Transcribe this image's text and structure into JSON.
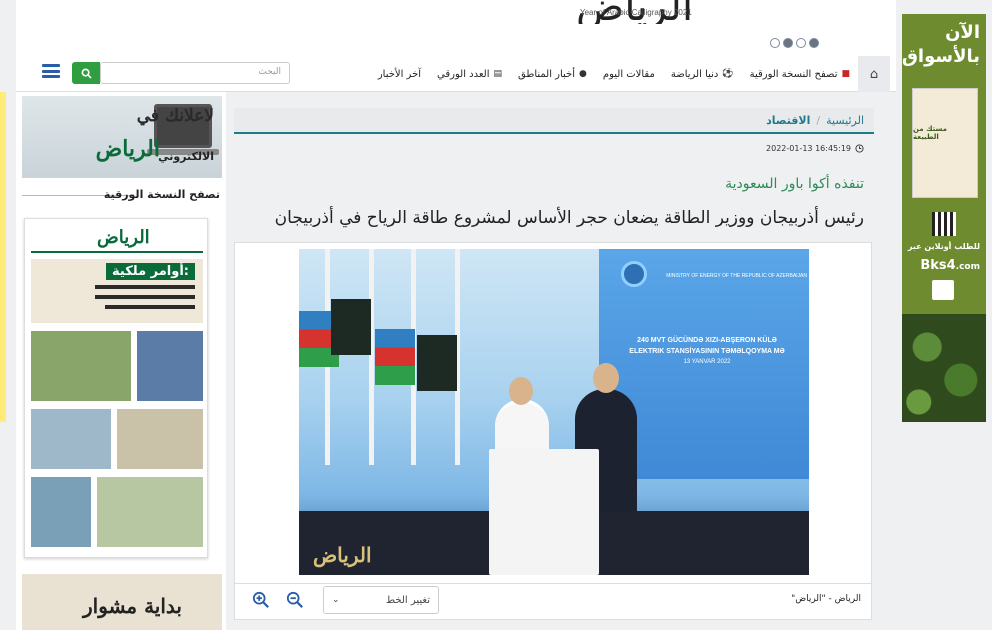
{
  "header": {
    "logo_text": "الرياض",
    "calligraphy_year": "Year of Arabic Calligraphy 2021",
    "slider_dots": [
      false,
      true,
      false,
      true
    ]
  },
  "nav": {
    "home_icon": "home-icon",
    "items": [
      {
        "label": "آخر الأخبار",
        "icon": ""
      },
      {
        "label": "العدد الورقي",
        "icon": "newspaper-icon"
      },
      {
        "label": "أخبار المناطق",
        "icon": "location-pin-icon"
      },
      {
        "label": "مقالات اليوم",
        "icon": ""
      },
      {
        "label": "دنيا الرياضة",
        "icon": "soccer-ball-icon"
      },
      {
        "label": "تصفح النسخة الورقية",
        "icon": "pdf-icon"
      }
    ],
    "search_placeholder": "البحث",
    "search_icon": "search-icon",
    "menu_icon": "hamburger-menu-icon"
  },
  "sidebar": {
    "ad_line1": "لاعلانك في",
    "ad_line2": "الرياض",
    "ad_line3": "الالكتروني",
    "paper_title": "تصفح النسخة الورقية",
    "paper_logo": "الرياض",
    "paper_headline": "أوامر ملكية:",
    "bottom_ad": "بداية مشوار"
  },
  "breadcrumb": {
    "home": "الرئيسية",
    "separator": "/",
    "current": "الاقتصاد"
  },
  "article": {
    "datetime": "2022-01-13 16:45:19",
    "clock_icon": "clock-icon",
    "kicker": "تنفذه أكوا باور السعودية",
    "headline": "رئيس أذربيجان ووزير الطاقة يضعان حجر الأساس لمشروع طاقة الرياح في أذربيجان",
    "photo_screen_line1": "240 MVT GÜCÜNDƏ XIZI-ABŞERON KÜLƏ",
    "photo_screen_line2": "ELEKTRIK STANSİYASININ TƏMƏLQOYMA MƏ",
    "photo_screen_date": "13 YANVAR 2022",
    "photo_screen_ministry": "MINISTRY OF ENERGY OF THE REPUBLIC OF AZERBAIJAN",
    "photo_watermark": "الرياض",
    "caption": "الرياض - \"الرياض\"",
    "font_select_label": "تغيير الخط",
    "zoom_in_icon": "zoom-in-icon",
    "zoom_out_icon": "zoom-out-icon"
  },
  "right_ad": {
    "line1": "الآن",
    "line2": "بالأسواق",
    "product": "مستك من الطبيعة",
    "order_text": "للطلب أونلاين عبر",
    "site": "Bks4",
    "site_tld": ".com"
  }
}
